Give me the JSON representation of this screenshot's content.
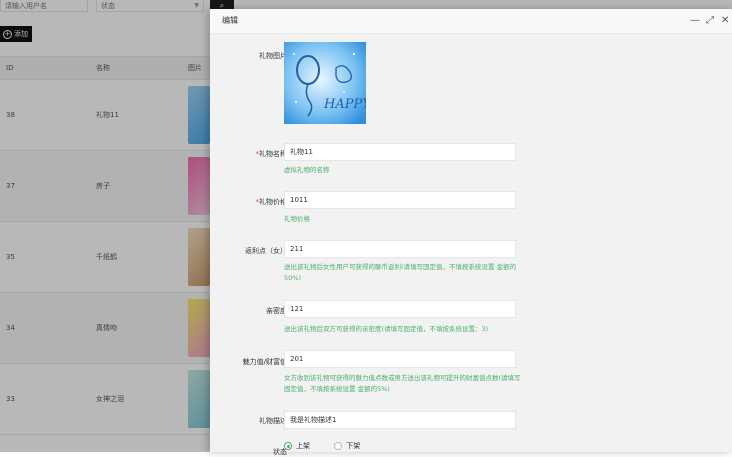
{
  "list": {
    "search_user_placeholder": "请输入用户名",
    "status_placeholder": "状态",
    "add_label": "添加",
    "columns": [
      "ID",
      "名称",
      "图片"
    ],
    "rows": [
      {
        "id": "38",
        "name": "礼物11"
      },
      {
        "id": "37",
        "name": "房子"
      },
      {
        "id": "35",
        "name": "千纸鹤"
      },
      {
        "id": "34",
        "name": "真情吻"
      },
      {
        "id": "33",
        "name": "女神之泪"
      }
    ]
  },
  "modal": {
    "title": "编辑",
    "fields": {
      "image_label": "礼物图片",
      "name_label": "礼物名称",
      "name_value": "礼物11",
      "name_hint": "虚拟礼物的名称",
      "price_label": "礼物价格",
      "price_value": "1011",
      "price_hint": "礼物价格",
      "rebate_label": "返利点（女）",
      "rebate_value": "211",
      "rebate_hint": "送出该礼物后女性用户可获得的聊币返利(请填写固定值，不填按系统设置 金额的50%)",
      "intimacy_label": "亲密度",
      "intimacy_value": "121",
      "intimacy_hint": "送出该礼物后双方可获得的亲密度(请填写固定值，不填按系统设置：3)",
      "charm_label": "魅力值/财富值",
      "charm_value": "201",
      "charm_hint": "女方收到该礼物可获得的魅力值点数或男方送出该礼物可提升的财富值点数(请填写固定值，不填按系统设置 金额的5%)",
      "desc_label": "礼物描述",
      "desc_value": "我是礼物描述1",
      "status_label": "状态",
      "status_on": "上架",
      "status_off": "下架",
      "status_selected": "上架"
    },
    "image_text": "HAPPY"
  },
  "colors": {
    "accent_green": "#4caf6a",
    "required_red": "#e0413a",
    "dark_button": "#111111"
  }
}
